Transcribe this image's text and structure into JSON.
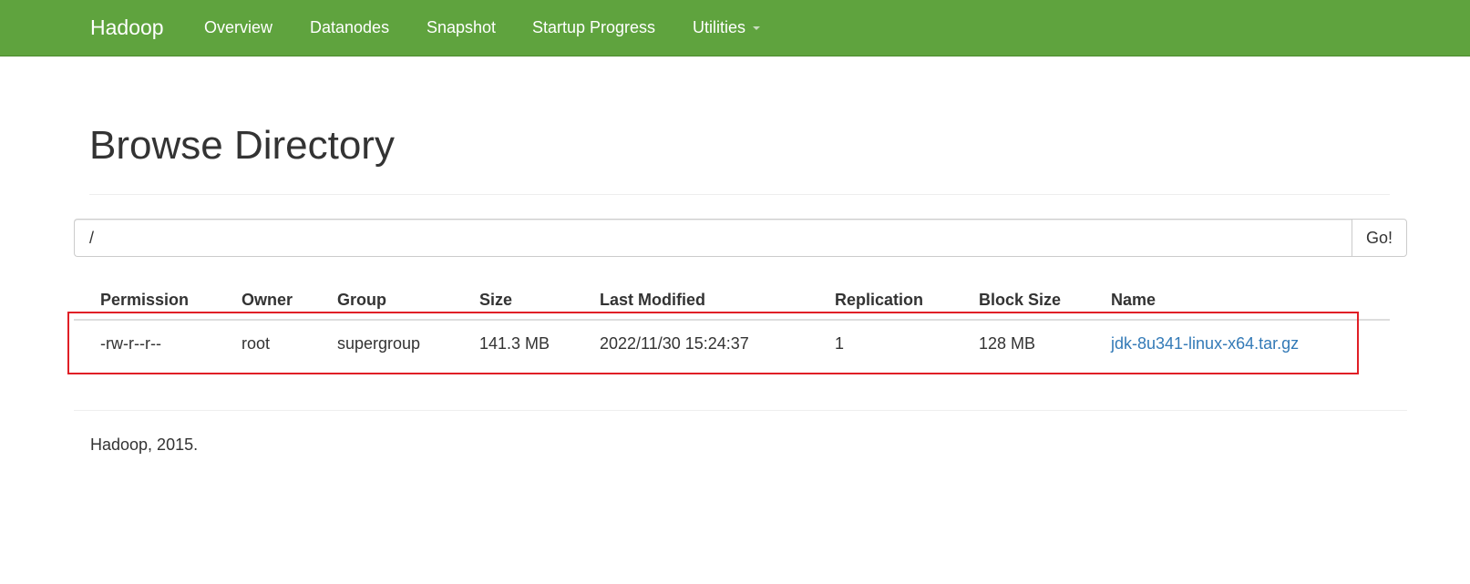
{
  "navbar": {
    "brand": "Hadoop",
    "items": [
      {
        "label": "Overview"
      },
      {
        "label": "Datanodes"
      },
      {
        "label": "Snapshot"
      },
      {
        "label": "Startup Progress"
      },
      {
        "label": "Utilities",
        "has_dropdown": true
      }
    ],
    "background_color": "#5fa33e"
  },
  "page": {
    "title": "Browse Directory"
  },
  "path_form": {
    "value": "/",
    "go_label": "Go!"
  },
  "table": {
    "columns": [
      "Permission",
      "Owner",
      "Group",
      "Size",
      "Last Modified",
      "Replication",
      "Block Size",
      "Name"
    ],
    "rows": [
      {
        "permission": "-rw-r--r--",
        "owner": "root",
        "group": "supergroup",
        "size": "141.3 MB",
        "last_modified": "2022/11/30 15:24:37",
        "replication": "1",
        "block_size": "128 MB",
        "name": "jdk-8u341-linux-x64.tar.gz"
      }
    ],
    "link_color": "#337ab7"
  },
  "highlight": {
    "color": "#e01f26"
  },
  "footer": {
    "text": "Hadoop, 2015."
  }
}
